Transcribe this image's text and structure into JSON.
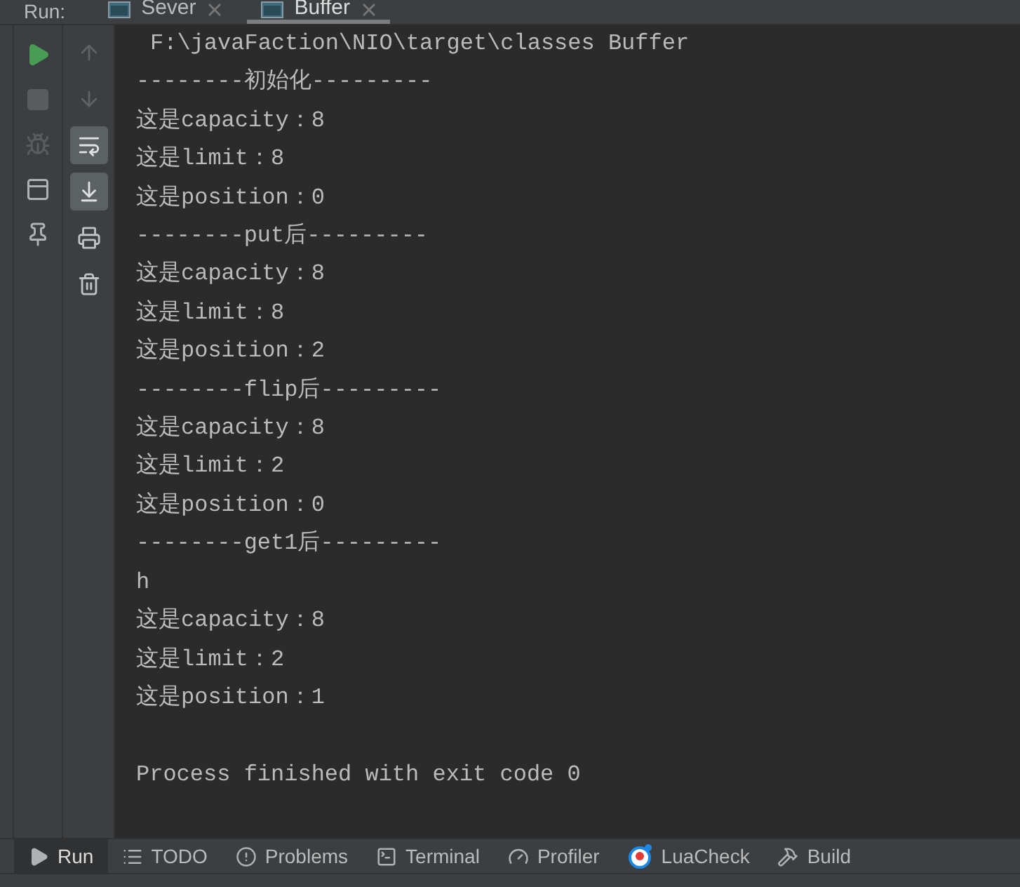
{
  "run_label": "Run:",
  "tabs": [
    {
      "label": "Sever",
      "selected": false
    },
    {
      "label": "Buffer",
      "selected": true
    }
  ],
  "main_toolbar": [
    {
      "kind": "play",
      "disabled": false
    },
    {
      "kind": "stop",
      "disabled": true
    },
    {
      "kind": "bug",
      "disabled": true
    },
    {
      "kind": "layout",
      "disabled": false
    },
    {
      "kind": "pin",
      "disabled": false
    }
  ],
  "secondary_toolbar": [
    {
      "kind": "up",
      "on": false
    },
    {
      "kind": "down",
      "on": false
    },
    {
      "kind": "wrap",
      "on": true
    },
    {
      "kind": "scroll",
      "on": true
    },
    {
      "kind": "print",
      "on": false
    },
    {
      "kind": "trash",
      "on": false
    }
  ],
  "console": {
    "command": "F:\\javaFaction\\NIO\\target\\classes Buffer",
    "lines": [
      "--------初始化---------",
      "这是capacity：8",
      "这是limit：8",
      "这是position：0",
      "--------put后---------",
      "这是capacity：8",
      "这是limit：8",
      "这是position：2",
      "--------flip后---------",
      "这是capacity：8",
      "这是limit：2",
      "这是position：0",
      "--------get1后---------",
      "h",
      "这是capacity：8",
      "这是limit：2",
      "这是position：1"
    ],
    "exit_line": "Process finished with exit code 0"
  },
  "tool_windows": [
    {
      "kind": "run",
      "label": "Run",
      "selected": true
    },
    {
      "kind": "todo",
      "label": "TODO",
      "selected": false
    },
    {
      "kind": "problems",
      "label": "Problems",
      "selected": false
    },
    {
      "kind": "terminal",
      "label": "Terminal",
      "selected": false
    },
    {
      "kind": "profiler",
      "label": "Profiler",
      "selected": false
    },
    {
      "kind": "luacheck",
      "label": "LuaCheck",
      "selected": false
    },
    {
      "kind": "build",
      "label": "Build",
      "selected": false
    }
  ]
}
